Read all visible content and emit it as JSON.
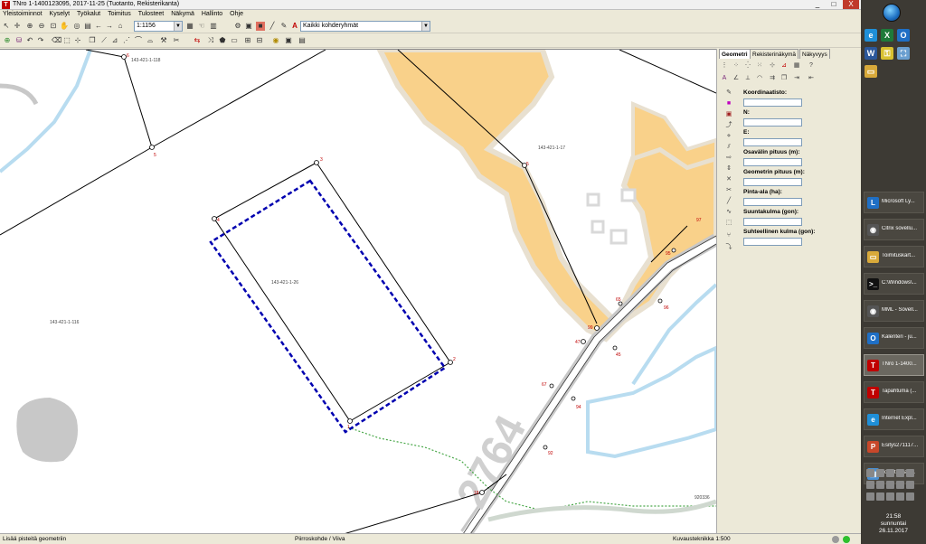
{
  "window": {
    "title": "TNro 1-1400123095, 2017-11-25 (Tuotanto, Rekisterikanta)",
    "icon_name": "app-logo-icon",
    "controls": [
      "_",
      "□",
      "X"
    ]
  },
  "menu": [
    "Yleistoiminnot",
    "Kyselyt",
    "Työkalut",
    "Toimitus",
    "Tulosteet",
    "Näkymä",
    "Hallinto",
    "Ohje"
  ],
  "toolbar": {
    "scale_value": "1:1156",
    "group_value": "Kaikki kohderyhmät"
  },
  "panel": {
    "tabs": [
      "Geometri",
      "Rekisterinäkymä",
      "Näkyvyys"
    ],
    "active_tab": "Geometri",
    "fields": [
      {
        "label": "Koordinaatisto:"
      },
      {
        "label": "N:"
      },
      {
        "label": "E:"
      },
      {
        "label": "Osavälin pituus (m):"
      },
      {
        "label": "Geometrin pituus (m):"
      },
      {
        "label": "Pinta-ala (ha):"
      },
      {
        "label": "Suuntakulma (gon):"
      },
      {
        "label": "Suhteellinen kulma (gon):"
      }
    ]
  },
  "map": {
    "parcel_labels": [
      {
        "text": "143-421-1-118"
      },
      {
        "text": "143-421-1-17"
      },
      {
        "text": "143-421-1-26"
      },
      {
        "text": "143-421-1-116"
      },
      {
        "text": "920336"
      }
    ],
    "road_number": "2764",
    "point_labels": [
      "6",
      "5",
      "3",
      "4",
      "2",
      "1",
      "5",
      "97",
      "95",
      "65",
      "96",
      "99",
      "47",
      "45",
      "67",
      "94",
      "92",
      "18"
    ]
  },
  "status": {
    "left": "Lisää pisteitä geometriin",
    "middle": "Piirroskohde / Viiva",
    "right": "Kuvausteknikka 1:500"
  },
  "taskbar": {
    "items": [
      {
        "label": "Microsoft Ly...",
        "icon": "lync-icon",
        "color": "#1f6fc5"
      },
      {
        "label": "Citrix sovellu...",
        "icon": "citrix-icon",
        "color": "#555555"
      },
      {
        "label": "Toimituskart...",
        "icon": "folder-icon",
        "color": "#d8a93a"
      },
      {
        "label": "C:\\Windows\\...",
        "icon": "cmd-icon",
        "color": "#111111"
      },
      {
        "label": "MML - Sovell...",
        "icon": "citrix-icon",
        "color": "#555555"
      },
      {
        "label": "Kalenteri - ju...",
        "icon": "outlook-icon",
        "color": "#1f6fc5"
      },
      {
        "label": "TNro 1-1400...",
        "icon": "app-logo-icon",
        "color": "#c00000"
      },
      {
        "label": "Tapahtuma (...",
        "icon": "app-logo-icon",
        "color": "#c00000"
      },
      {
        "label": "Internet Expl...",
        "icon": "ie-icon",
        "color": "#1f8fd8"
      },
      {
        "label": "Esitys271117...",
        "icon": "powerpoint-icon",
        "color": "#c8472a"
      },
      {
        "label": "Toimituskart...",
        "icon": "explorer-icon",
        "color": "#4a8fd0"
      }
    ],
    "active_index": 6,
    "clock_time": "21:58",
    "clock_day": "sunnuntai",
    "clock_date": "26.11.2017"
  }
}
